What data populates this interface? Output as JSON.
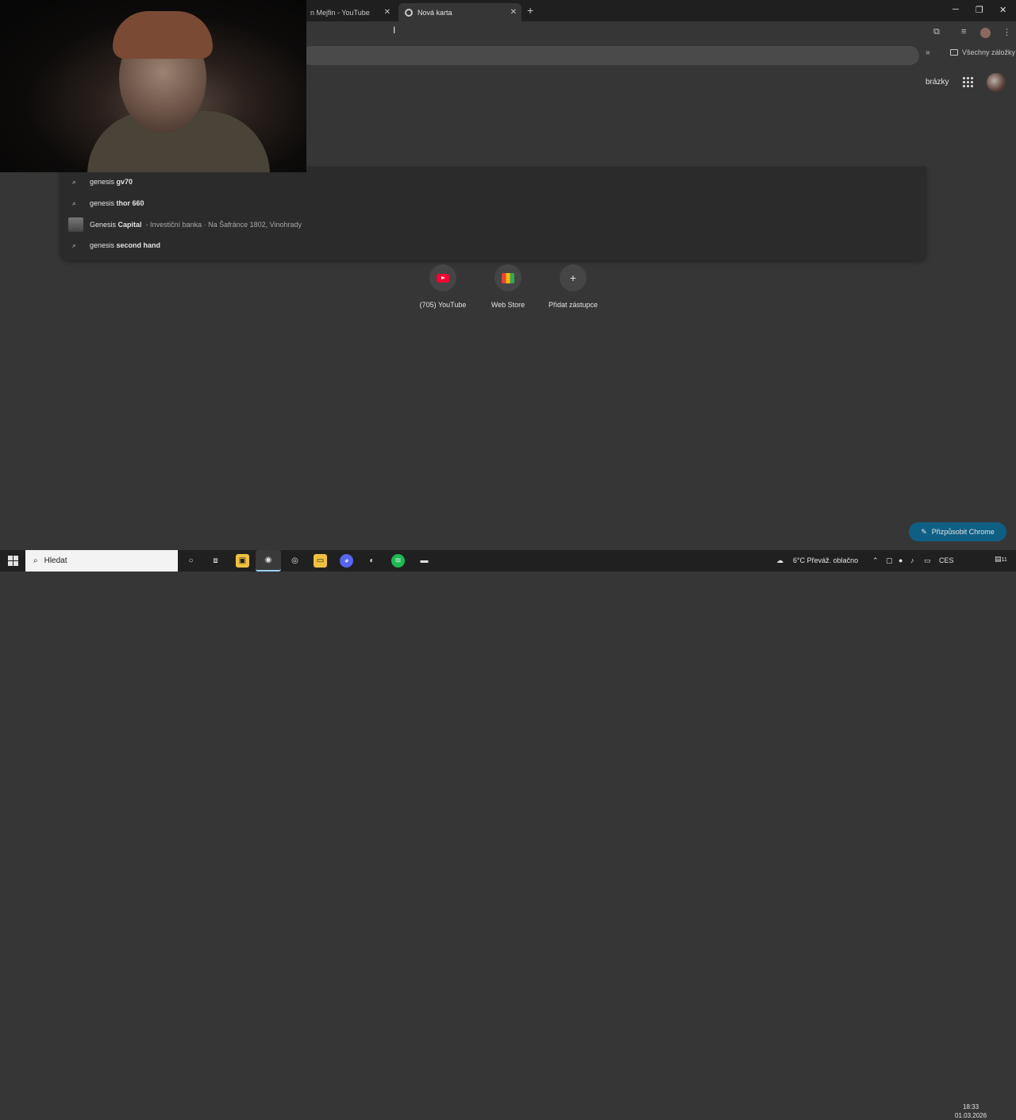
{
  "tabs": [
    {
      "title": "n Mejfin - YouTube",
      "active": false
    },
    {
      "title": "Nová karta",
      "active": true
    }
  ],
  "bookmarks": {
    "all_label": "Všechny záložky"
  },
  "header": {
    "images_label": "brázky"
  },
  "suggestions": [
    {
      "type": "search",
      "prefix": "genesis ",
      "bold": "gv70",
      "sub": ""
    },
    {
      "type": "search",
      "prefix": "genesis ",
      "bold": "thor 660",
      "sub": ""
    },
    {
      "type": "place",
      "prefix": "Genesis ",
      "bold": "Capital",
      "sub": "-   Investiční banka · Na Šafránce 1802, Vinohrady"
    },
    {
      "type": "search",
      "prefix": "genesis ",
      "bold": "second hand",
      "sub": ""
    }
  ],
  "shortcuts": [
    {
      "label": "(705) YouTube",
      "icon": "youtube-icon"
    },
    {
      "label": "Web Store",
      "icon": "webstore-icon"
    },
    {
      "label": "Přidat zástupce",
      "icon": "plus-icon"
    }
  ],
  "customize_label": "Přizpůsobit Chrome",
  "taskbar": {
    "search_placeholder": "Hledat",
    "weather": "6°C  Převáž. oblačno",
    "lang": "CES",
    "time": "18:33",
    "date": "01.03.2026",
    "notif_count": "11"
  },
  "colors": {
    "accent": "#0f5f85",
    "bg": "#363636",
    "tabstrip": "#1f1f1f"
  }
}
